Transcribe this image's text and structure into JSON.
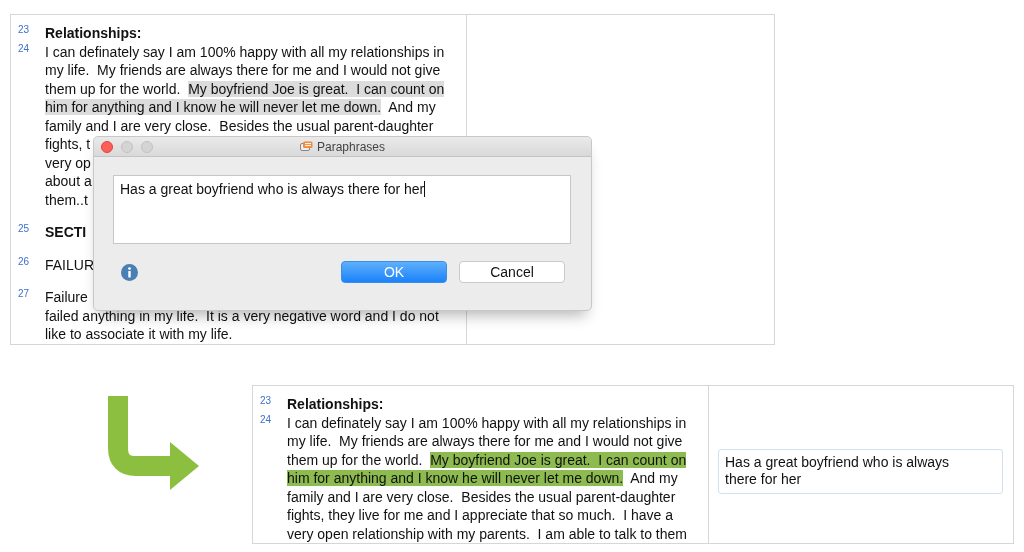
{
  "top_view": {
    "blocks": [
      {
        "number": "23",
        "lines": [
          {
            "kind": "heading",
            "segments": [
              {
                "text": "Relationships:",
                "highlighted": false
              }
            ]
          }
        ]
      },
      {
        "number": "24",
        "lines": [
          {
            "kind": "body",
            "segments": [
              {
                "text": "I can definately say I am 100% happy with all my relationships in",
                "highlighted": false
              }
            ]
          },
          {
            "kind": "body",
            "segments": [
              {
                "text": "my life.  My friends are always there for me and I would not give",
                "highlighted": false
              }
            ]
          },
          {
            "kind": "body",
            "segments": [
              {
                "text": "them up for the world.  ",
                "highlighted": false
              },
              {
                "text": "My boyfriend Joe is great.  I can count on",
                "highlighted": true,
                "color": "#dcdcdc"
              }
            ]
          },
          {
            "kind": "body",
            "segments": [
              {
                "text": "him for anything and I know he will never let me down.",
                "highlighted": true,
                "color": "#dcdcdc"
              },
              {
                "text": "  And my",
                "highlighted": false
              }
            ]
          },
          {
            "kind": "body",
            "segments": [
              {
                "text": "family and I are very close.  Besides the usual parent-daughter",
                "highlighted": false
              }
            ]
          },
          {
            "kind": "body",
            "segments": [
              {
                "text": "fights, t",
                "highlighted": false
              }
            ]
          },
          {
            "kind": "body",
            "segments": [
              {
                "text": "very op",
                "highlighted": false
              }
            ]
          },
          {
            "kind": "body",
            "segments": [
              {
                "text": "about a",
                "highlighted": false
              }
            ]
          },
          {
            "kind": "body",
            "segments": [
              {
                "text": "them..t",
                "highlighted": false
              }
            ]
          }
        ]
      },
      {
        "number": "25",
        "lines": [
          {
            "kind": "heading",
            "segments": [
              {
                "text": "SECTI",
                "highlighted": false
              }
            ]
          }
        ]
      },
      {
        "number": "26",
        "lines": [
          {
            "kind": "body",
            "segments": [
              {
                "text": "FAILUR",
                "highlighted": false
              }
            ]
          }
        ]
      },
      {
        "number": "27",
        "lines": [
          {
            "kind": "body",
            "segments": [
              {
                "text": "Failure",
                "highlighted": false
              }
            ]
          },
          {
            "kind": "body",
            "segments": [
              {
                "text": "failed anything in my life.  It is a very negative word and I do not",
                "highlighted": false
              }
            ]
          },
          {
            "kind": "body",
            "segments": [
              {
                "text": "like to associate it with my life.",
                "highlighted": false
              }
            ]
          }
        ]
      }
    ],
    "dialog": {
      "title": "Paraphrases",
      "value": "Has a great boyfriend who is always there for her",
      "buttons": [
        {
          "label": "OK",
          "default": true
        },
        {
          "label": "Cancel",
          "default": false
        }
      ]
    }
  },
  "bottom_view": {
    "blocks": [
      {
        "number": "23",
        "lines": [
          {
            "kind": "heading",
            "segments": [
              {
                "text": "Relationships:",
                "highlighted": false
              }
            ]
          }
        ]
      },
      {
        "number": "24",
        "lines": [
          {
            "kind": "body",
            "segments": [
              {
                "text": "I can definately say I am 100% happy with all my relationships in",
                "highlighted": false
              }
            ]
          },
          {
            "kind": "body",
            "segments": [
              {
                "text": "my life.  My friends are always there for me and I would not give",
                "highlighted": false
              }
            ]
          },
          {
            "kind": "body",
            "segments": [
              {
                "text": "them up for the world.  ",
                "highlighted": false
              },
              {
                "text": "My boyfriend Joe is great.  I can count on",
                "highlighted": true,
                "color": "#8dbb4f"
              }
            ]
          },
          {
            "kind": "body",
            "segments": [
              {
                "text": "him for anything and I know he will never let me down.",
                "highlighted": true,
                "color": "#8dbb4f"
              },
              {
                "text": "  And my",
                "highlighted": false
              }
            ]
          },
          {
            "kind": "body",
            "segments": [
              {
                "text": "family and I are very close.  Besides the usual parent-daughter",
                "highlighted": false
              }
            ]
          },
          {
            "kind": "body",
            "segments": [
              {
                "text": "fights, they live for me and I appreciate that so much.  I have a",
                "highlighted": false
              }
            ]
          },
          {
            "kind": "body",
            "segments": [
              {
                "text": "very open relationship with my parents.  I am able to talk to them",
                "highlighted": false
              }
            ]
          }
        ]
      }
    ],
    "paraphrase": "Has a great boyfriend who is always there for her"
  }
}
